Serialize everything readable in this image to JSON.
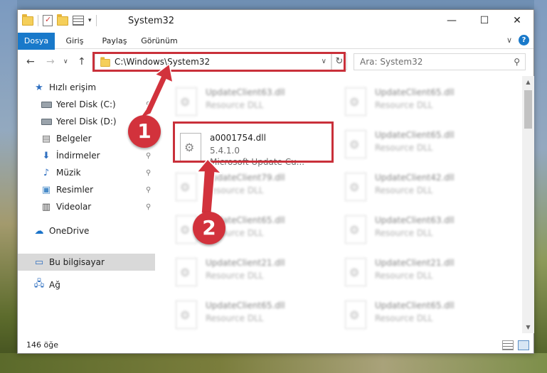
{
  "window": {
    "title": "System32",
    "controls": {
      "minimize": "—",
      "maximize": "☐",
      "close": "✕"
    }
  },
  "ribbon": {
    "tabs": [
      "Dosya",
      "Giriş",
      "Paylaş",
      "Görünüm"
    ],
    "expand_glyph": "∨",
    "help_glyph": "?"
  },
  "navbar": {
    "back": "←",
    "forward": "→",
    "recent": "∨",
    "up": "↑",
    "address": "C:\\Windows\\System32",
    "address_drop": "∨",
    "refresh": "↻",
    "search_placeholder": "Ara: System32",
    "search_icon_glyph": "⚲"
  },
  "sidebar": {
    "items": [
      {
        "label": "Hızlı erişim",
        "icon": "star-icon",
        "pinned": false
      },
      {
        "label": "Yerel Disk (C:)",
        "icon": "drive-icon",
        "pinned": true
      },
      {
        "label": "Yerel Disk (D:)",
        "icon": "drive-icon",
        "pinned": true
      },
      {
        "label": "Belgeler",
        "icon": "documents-icon",
        "pinned": true
      },
      {
        "label": "İndirmeler",
        "icon": "download-icon",
        "pinned": true
      },
      {
        "label": "Müzik",
        "icon": "music-icon",
        "pinned": true
      },
      {
        "label": "Resimler",
        "icon": "pictures-icon",
        "pinned": true
      },
      {
        "label": "Videolar",
        "icon": "videos-icon",
        "pinned": true
      },
      {
        "label": "OneDrive",
        "icon": "onedrive-icon",
        "pinned": false
      },
      {
        "label": "Bu bilgisayar",
        "icon": "computer-icon",
        "pinned": false,
        "selected": true
      },
      {
        "label": "Ağ",
        "icon": "network-icon",
        "pinned": false
      }
    ],
    "pin_glyph": "📌"
  },
  "files": {
    "left": [
      {
        "name": "UpdateClient63.dll",
        "desc": "Resource DLL"
      },
      {
        "name": "a0001754.dll",
        "version": "5.4.1.0",
        "desc": "Microsoft Update Cu...",
        "focused": true
      },
      {
        "name": "UpdateClient79.dll",
        "desc": "Resource DLL"
      },
      {
        "name": "UpdateClient65.dll",
        "desc": "Resource DLL"
      },
      {
        "name": "UpdateClient21.dll",
        "desc": "Resource DLL"
      },
      {
        "name": "UpdateClient65.dll",
        "desc": "Resource DLL"
      }
    ],
    "right": [
      {
        "name": "UpdateClient65.dll",
        "desc": "Resource DLL"
      },
      {
        "name": "UpdateClient65.dll",
        "desc": "Resource DLL"
      },
      {
        "name": "UpdateClient42.dll",
        "desc": "Resource DLL"
      },
      {
        "name": "UpdateClient63.dll",
        "desc": "Resource DLL"
      },
      {
        "name": "UpdateClient21.dll",
        "desc": "Resource DLL"
      },
      {
        "name": "UpdateClient65.dll",
        "desc": "Resource DLL"
      }
    ]
  },
  "status": {
    "count": "146 öğe"
  },
  "annotations": {
    "step1": "1",
    "step2": "2",
    "color": "#d2323c"
  },
  "colors": {
    "accent": "#1979ca",
    "highlight": "#c9303a"
  }
}
